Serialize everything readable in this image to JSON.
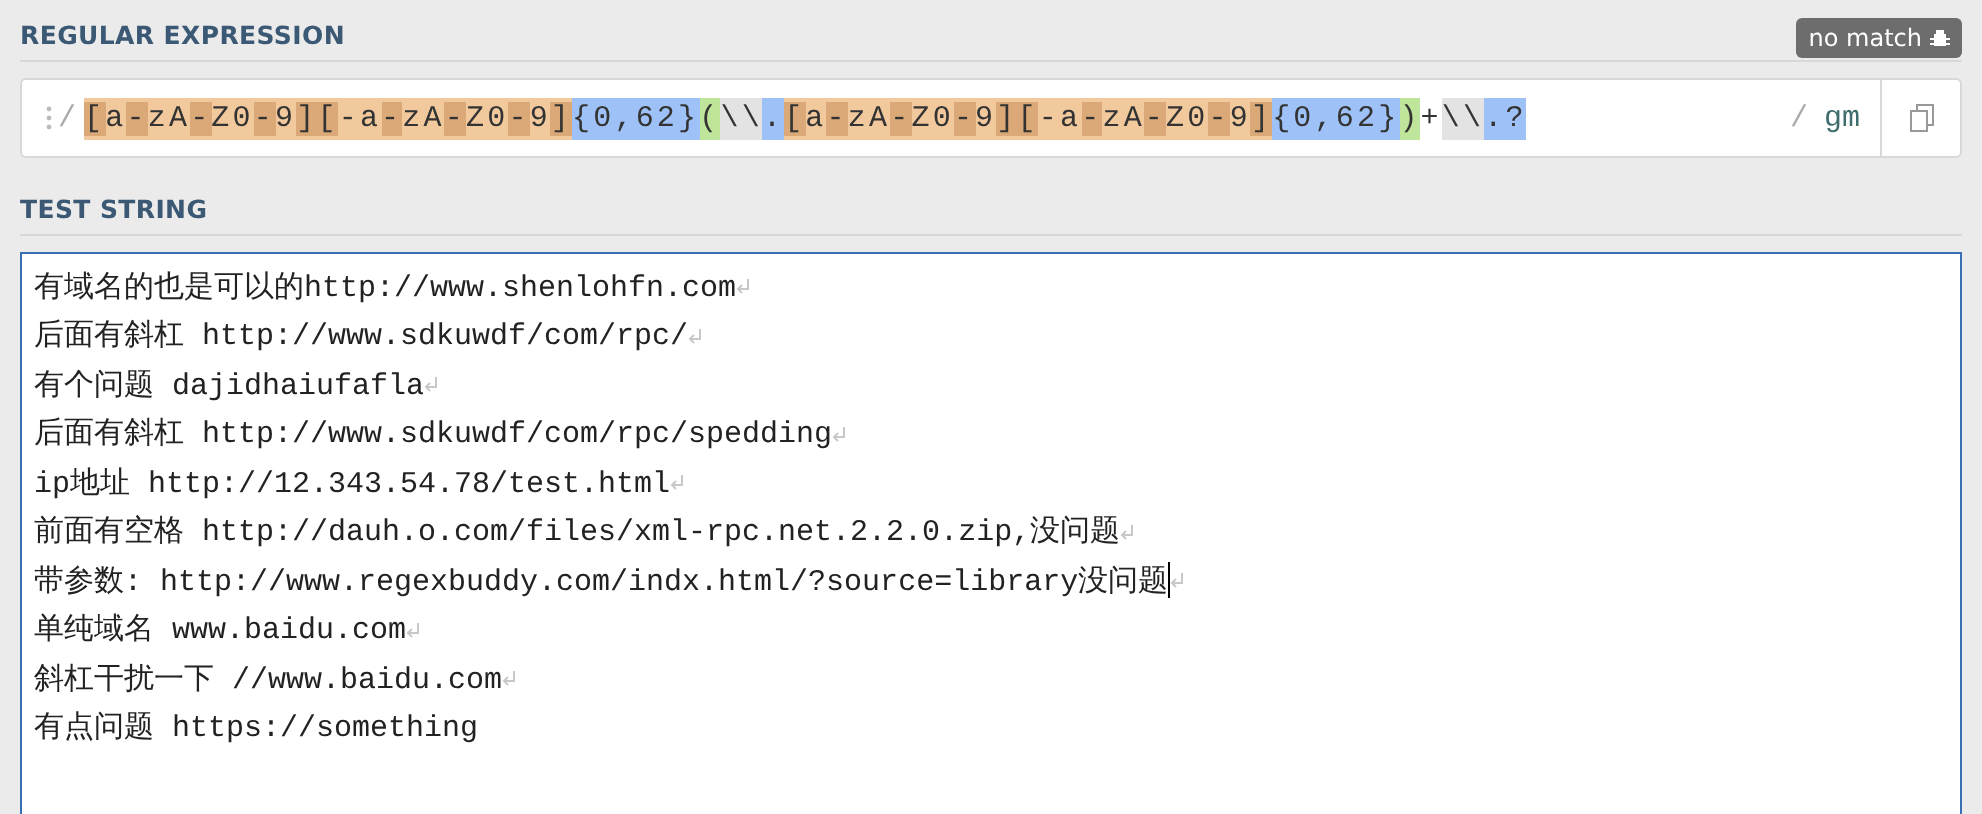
{
  "regex_section": {
    "title": "REGULAR EXPRESSION",
    "status_badge": "no match",
    "delimiter_open": "/",
    "delimiter_close": "/",
    "flags": "gm",
    "tokens": [
      {
        "kind": "charclass",
        "text": "[a-zA-Z0-9]"
      },
      {
        "kind": "charclass",
        "text": "[-a-zA-Z0-9]"
      },
      {
        "kind": "quantifier",
        "text": "{0,62}"
      },
      {
        "kind": "group",
        "text": "("
      },
      {
        "kind": "escape",
        "text": "\\\\"
      },
      {
        "kind": "meta",
        "text": "."
      },
      {
        "kind": "charclass",
        "text": "[a-zA-Z0-9]"
      },
      {
        "kind": "charclass",
        "text": "[-a-zA-Z0-9]"
      },
      {
        "kind": "quantifier",
        "text": "{0,62}"
      },
      {
        "kind": "group",
        "text": ")"
      },
      {
        "kind": "plain",
        "text": "+"
      },
      {
        "kind": "escape",
        "text": "\\\\"
      },
      {
        "kind": "meta",
        "text": ".?"
      }
    ]
  },
  "test_section": {
    "title": "TEST STRING",
    "lines": [
      {
        "text": "有域名的也是可以的http://www.shenlohfn.com",
        "line_break": true,
        "cursor": false
      },
      {
        "text": "后面有斜杠 http://www.sdkuwdf/com/rpc/",
        "line_break": true,
        "cursor": false
      },
      {
        "text": "有个问题 dajidhaiufafla",
        "line_break": true,
        "cursor": false
      },
      {
        "text": "后面有斜杠 http://www.sdkuwdf/com/rpc/spedding",
        "line_break": true,
        "cursor": false
      },
      {
        "text": "ip地址 http://12.343.54.78/test.html",
        "line_break": true,
        "cursor": false
      },
      {
        "text": "前面有空格 http://dauh.o.com/files/xml-rpc.net.2.2.0.zip,没问题",
        "line_break": true,
        "cursor": false
      },
      {
        "text": "带参数: http://www.regexbuddy.com/indx.html/?source=library没问题",
        "line_break": true,
        "cursor": true
      },
      {
        "text": "单纯域名 www.baidu.com",
        "line_break": true,
        "cursor": false
      },
      {
        "text": "斜杠干扰一下 //www.baidu.com",
        "line_break": true,
        "cursor": false
      },
      {
        "text": "有点问题 https://something",
        "line_break": false,
        "cursor": false
      }
    ]
  }
}
